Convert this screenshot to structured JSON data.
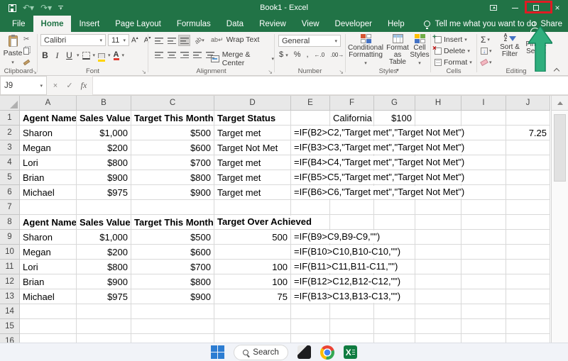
{
  "colors": {
    "excel_green": "#217346",
    "annotation_red": "#e01b24",
    "annotation_green": "#2fae7d"
  },
  "titlebar": {
    "title": "Book1 - Excel"
  },
  "tabs": [
    {
      "label": "File",
      "active": false
    },
    {
      "label": "Home",
      "active": true
    },
    {
      "label": "Insert",
      "active": false
    },
    {
      "label": "Page Layout",
      "active": false
    },
    {
      "label": "Formulas",
      "active": false
    },
    {
      "label": "Data",
      "active": false
    },
    {
      "label": "Review",
      "active": false
    },
    {
      "label": "View",
      "active": false
    },
    {
      "label": "Developer",
      "active": false
    },
    {
      "label": "Help",
      "active": false
    }
  ],
  "tellme": {
    "label": "Tell me what you want to do"
  },
  "share": {
    "label": "Share"
  },
  "ribbon": {
    "clipboard": {
      "paste": "Paste",
      "label": "Clipboard"
    },
    "font": {
      "family": "Calibri",
      "size": "11",
      "label": "Font"
    },
    "alignment": {
      "wrap": "Wrap Text",
      "merge": "Merge & Center",
      "label": "Alignment"
    },
    "number": {
      "format": "General",
      "label": "Number"
    },
    "styles": {
      "conditional": "Conditional Formatting",
      "format_table": "Format as Table",
      "cell_styles": "Cell Styles",
      "label": "Styles"
    },
    "cells": {
      "insert": "Insert",
      "delete": "Delete",
      "format": "Format",
      "label": "Cells"
    },
    "editing": {
      "sort": "Sort & Filter",
      "find": "Find & Select",
      "label": "Editing"
    }
  },
  "formula_bar": {
    "name_box": "J9",
    "formula": ""
  },
  "sheet": {
    "columns": [
      "A",
      "B",
      "C",
      "D",
      "E",
      "F",
      "G",
      "H",
      "I",
      "J"
    ],
    "row_count": 17,
    "cells": [
      {
        "ref": "A1",
        "v": "Agent Name",
        "b": 1
      },
      {
        "ref": "B1",
        "v": "Sales Value",
        "b": 1
      },
      {
        "ref": "C1",
        "v": "Target This Month",
        "b": 1
      },
      {
        "ref": "D1",
        "v": "Target Status",
        "b": 1
      },
      {
        "ref": "F1",
        "v": "California"
      },
      {
        "ref": "G1",
        "v": "$100",
        "a": "r"
      },
      {
        "ref": "A2",
        "v": "Sharon"
      },
      {
        "ref": "B2",
        "v": "$1,000",
        "a": "r"
      },
      {
        "ref": "C2",
        "v": "$500",
        "a": "r"
      },
      {
        "ref": "D2",
        "v": "Target met"
      },
      {
        "ref": "E2",
        "v": "=IF(B2>C2,\"Target met\",\"Target Not Met\")",
        "o": 1
      },
      {
        "ref": "J2",
        "v": "7.25",
        "a": "r"
      },
      {
        "ref": "A3",
        "v": "Megan"
      },
      {
        "ref": "B3",
        "v": "$200",
        "a": "r"
      },
      {
        "ref": "C3",
        "v": "$600",
        "a": "r"
      },
      {
        "ref": "D3",
        "v": "Target Not Met"
      },
      {
        "ref": "E3",
        "v": "=IF(B3>C3,\"Target met\",\"Target Not Met\")",
        "o": 1
      },
      {
        "ref": "A4",
        "v": "Lori"
      },
      {
        "ref": "B4",
        "v": "$800",
        "a": "r"
      },
      {
        "ref": "C4",
        "v": "$700",
        "a": "r"
      },
      {
        "ref": "D4",
        "v": "Target met"
      },
      {
        "ref": "E4",
        "v": "=IF(B4>C4,\"Target met\",\"Target Not Met\")",
        "o": 1
      },
      {
        "ref": "A5",
        "v": "Brian"
      },
      {
        "ref": "B5",
        "v": "$900",
        "a": "r"
      },
      {
        "ref": "C5",
        "v": "$800",
        "a": "r"
      },
      {
        "ref": "D5",
        "v": "Target met"
      },
      {
        "ref": "E5",
        "v": "=IF(B5>C5,\"Target met\",\"Target Not Met\")",
        "o": 1
      },
      {
        "ref": "A6",
        "v": "Michael"
      },
      {
        "ref": "B6",
        "v": "$975",
        "a": "r"
      },
      {
        "ref": "C6",
        "v": "$900",
        "a": "r"
      },
      {
        "ref": "D6",
        "v": "Target met"
      },
      {
        "ref": "E6",
        "v": "=IF(B6>C6,\"Target met\",\"Target Not Met\")",
        "o": 1
      },
      {
        "ref": "A8",
        "v": "Agent Name",
        "b": 1
      },
      {
        "ref": "B8",
        "v": "Sales Value",
        "b": 1
      },
      {
        "ref": "C8",
        "v": "Target This Month",
        "b": 1
      },
      {
        "ref": "D8",
        "v": "Target Over Achieved",
        "b": 1,
        "o": 1
      },
      {
        "ref": "A9",
        "v": "Sharon"
      },
      {
        "ref": "B9",
        "v": "$1,000",
        "a": "r"
      },
      {
        "ref": "C9",
        "v": "$500",
        "a": "r"
      },
      {
        "ref": "D9",
        "v": "500",
        "a": "r"
      },
      {
        "ref": "E9",
        "v": "=IF(B9>C9,B9-C9,\"\")",
        "o": 1
      },
      {
        "ref": "A10",
        "v": "Megan"
      },
      {
        "ref": "B10",
        "v": "$200",
        "a": "r"
      },
      {
        "ref": "C10",
        "v": "$600",
        "a": "r"
      },
      {
        "ref": "E10",
        "v": "=IF(B10>C10,B10-C10,\"\")",
        "o": 1
      },
      {
        "ref": "A11",
        "v": "Lori"
      },
      {
        "ref": "B11",
        "v": "$800",
        "a": "r"
      },
      {
        "ref": "C11",
        "v": "$700",
        "a": "r"
      },
      {
        "ref": "D11",
        "v": "100",
        "a": "r"
      },
      {
        "ref": "E11",
        "v": "=IF(B11>C11,B11-C11,\"\")",
        "o": 1
      },
      {
        "ref": "A12",
        "v": "Brian"
      },
      {
        "ref": "B12",
        "v": "$900",
        "a": "r"
      },
      {
        "ref": "C12",
        "v": "$800",
        "a": "r"
      },
      {
        "ref": "D12",
        "v": "100",
        "a": "r"
      },
      {
        "ref": "E12",
        "v": "=IF(B12>C12,B12-C12,\"\")",
        "o": 1
      },
      {
        "ref": "A13",
        "v": "Michael"
      },
      {
        "ref": "B13",
        "v": "$975",
        "a": "r"
      },
      {
        "ref": "C13",
        "v": "$900",
        "a": "r"
      },
      {
        "ref": "D13",
        "v": "75",
        "a": "r"
      },
      {
        "ref": "E13",
        "v": "=IF(B13>C13,B13-C13,\"\")",
        "o": 1
      }
    ]
  },
  "taskbar": {
    "search_label": "Search"
  }
}
